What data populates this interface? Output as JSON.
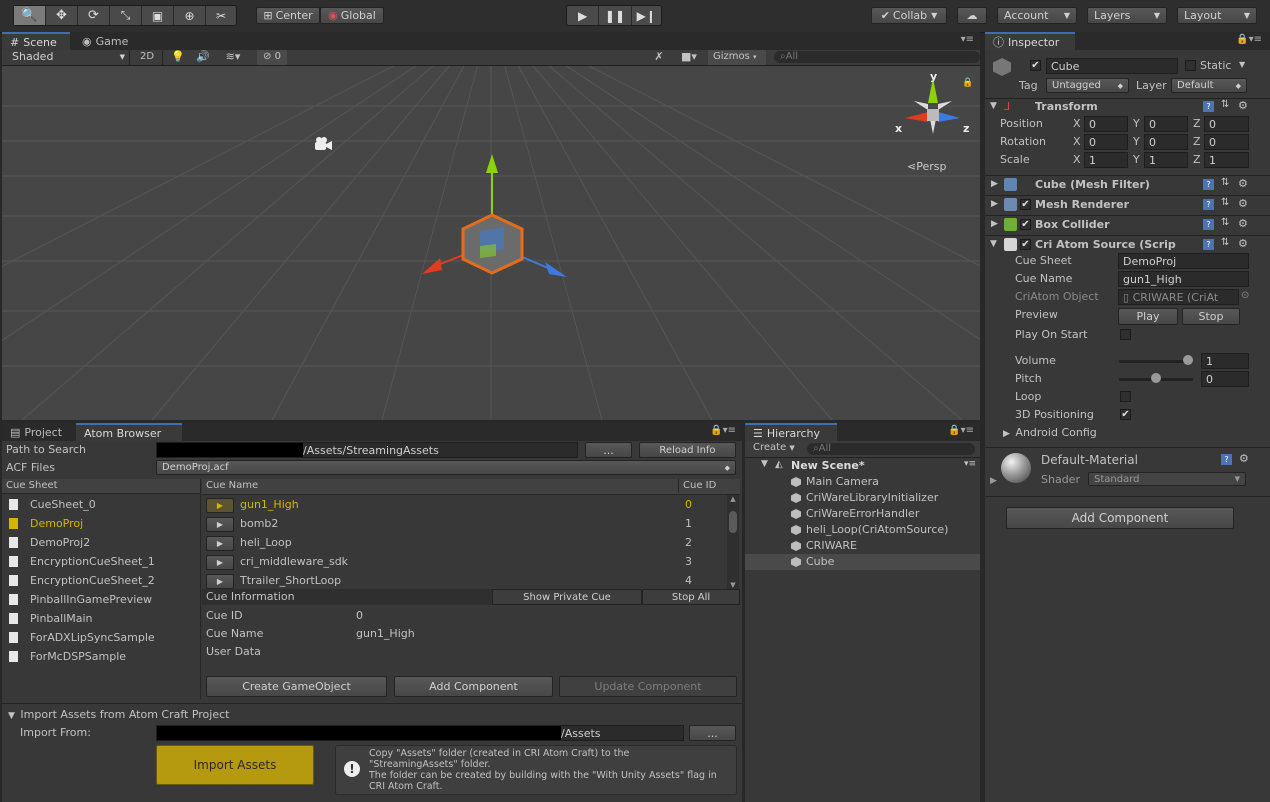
{
  "toolbar": {
    "center_label": "Center",
    "global_label": "Global",
    "collab_label": "Collab",
    "account_label": "Account",
    "layers_label": "Layers",
    "layout_label": "Layout"
  },
  "scene": {
    "tab_scene": "Scene",
    "tab_game": "Game",
    "shading": "Shaded",
    "mode_2d": "2D",
    "hidden_count": "0",
    "gizmos": "Gizmos",
    "search_placeholder": "All",
    "persp": "Persp",
    "axis_x": "x",
    "axis_y": "y",
    "axis_z": "z"
  },
  "inspector": {
    "tab": "Inspector",
    "object_name": "Cube",
    "static_label": "Static",
    "tag_label": "Tag",
    "tag_value": "Untagged",
    "layer_label": "Layer",
    "layer_value": "Default",
    "transform": {
      "title": "Transform",
      "rows": [
        {
          "label": "Position",
          "x": "0",
          "y": "0",
          "z": "0"
        },
        {
          "label": "Rotation",
          "x": "0",
          "y": "0",
          "z": "0"
        },
        {
          "label": "Scale",
          "x": "1",
          "y": "1",
          "z": "1"
        }
      ],
      "x": "X",
      "y": "Y",
      "z": "Z"
    },
    "components": {
      "mesh_filter": "Cube (Mesh Filter)",
      "mesh_renderer": "Mesh Renderer",
      "box_collider": "Box Collider",
      "atom_source": "Cri Atom Source (Scrip"
    },
    "atom": {
      "cue_sheet_label": "Cue Sheet",
      "cue_sheet_value": "DemoProj",
      "cue_name_label": "Cue Name",
      "cue_name_value": "gun1_High",
      "atom_object_label": "CriAtom Object",
      "atom_object_value": "CRIWARE (CriAt",
      "preview_label": "Preview",
      "play": "Play",
      "stop": "Stop",
      "play_on_start": "Play On Start",
      "volume_label": "Volume",
      "volume_value": "1",
      "volume_level": 1.0,
      "pitch_label": "Pitch",
      "pitch_value": "0",
      "pitch_level": 0.5,
      "loop_label": "Loop",
      "positioning_label": "3D Positioning",
      "android_config": "Android Config"
    },
    "material": {
      "name": "Default-Material",
      "shader_label": "Shader",
      "shader_value": "Standard"
    },
    "add_component": "Add Component"
  },
  "atom_browser": {
    "tab_project": "Project",
    "tab_atom": "Atom Browser",
    "path_label": "Path to Search",
    "path_value": "/Assets/StreamingAssets",
    "browse": "...",
    "reload": "Reload Info",
    "acf_label": "ACF Files",
    "acf_value": "DemoProj.acf",
    "cue_sheet_header": "Cue Sheet",
    "cue_sheets": [
      "CueSheet_0",
      "DemoProj",
      "DemoProj2",
      "EncryptionCueSheet_1",
      "EncryptionCueSheet_2",
      "PinballInGamePreview",
      "PinballMain",
      "ForADXLipSyncSample",
      "ForMcDSPSample"
    ],
    "cue_name_header": "Cue Name",
    "cue_id_header": "Cue ID",
    "cues": [
      {
        "name": "gun1_High",
        "id": "0"
      },
      {
        "name": "bomb2",
        "id": "1"
      },
      {
        "name": "heli_Loop",
        "id": "2"
      },
      {
        "name": "cri_middleware_sdk",
        "id": "3"
      },
      {
        "name": "Ttrailer_ShortLoop",
        "id": "4"
      }
    ],
    "cue_info_title": "Cue Information",
    "show_private": "Show Private Cue",
    "stop_all": "Stop All",
    "info_cue_id_label": "Cue ID",
    "info_cue_id_value": "0",
    "info_cue_name_label": "Cue Name",
    "info_cue_name_value": "gun1_High",
    "info_user_data_label": "User Data",
    "create_go": "Create GameObject",
    "add_component": "Add Component",
    "update_component": "Update Component",
    "import_title": "Import Assets from Atom Craft Project",
    "import_from_label": "Import From:",
    "import_from_value": "/Assets",
    "import_browse": "...",
    "import_button": "Import Assets",
    "info_line1": "Copy \"Assets\" folder (created in CRI Atom Craft) to the",
    "info_line2": "\"StreamingAssets\" folder.",
    "info_line3": "The folder can be created by building with the \"With Unity Assets\" flag in",
    "info_line4": "CRI Atom Craft."
  },
  "hierarchy": {
    "tab": "Hierarchy",
    "create": "Create",
    "search_placeholder": "All",
    "scene_name": "New Scene*",
    "items": [
      "Main Camera",
      "CriWareLibraryInitializer",
      "CriWareErrorHandler",
      "heli_Loop(CriAtomSource)",
      "CRIWARE",
      "Cube"
    ]
  },
  "colors": {
    "selection": "#3e5f96",
    "highlight_text": "#d4b500",
    "import_button": "#b59a10"
  }
}
